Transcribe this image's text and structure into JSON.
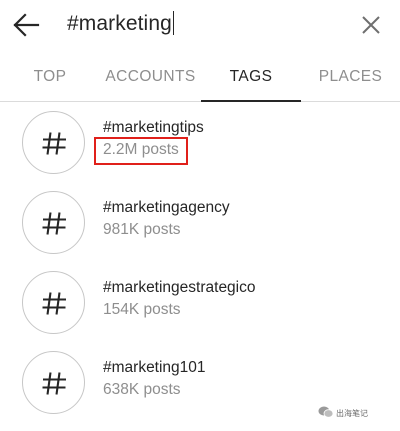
{
  "search": {
    "query": "#marketing",
    "back_icon": "arrow-left-icon",
    "clear_icon": "close-icon"
  },
  "tabs": [
    {
      "label": "TOP",
      "active": false
    },
    {
      "label": "ACCOUNTS",
      "active": false
    },
    {
      "label": "TAGS",
      "active": true
    },
    {
      "label": "PLACES",
      "active": false
    }
  ],
  "results": [
    {
      "tag": "#marketingtips",
      "posts": "2.2M posts",
      "highlighted": true
    },
    {
      "tag": "#marketingagency",
      "posts": "981K posts",
      "highlighted": false
    },
    {
      "tag": "#marketingestrategico",
      "posts": "154K posts",
      "highlighted": false
    },
    {
      "tag": "#marketing101",
      "posts": "638K posts",
      "highlighted": false
    }
  ],
  "watermark": {
    "text": "出海笔记",
    "icon": "wechat-icon"
  },
  "colors": {
    "text_primary": "#262626",
    "text_secondary": "#8e8e8e",
    "divider": "#dbdbdb",
    "highlight_box": "#e0201a"
  }
}
